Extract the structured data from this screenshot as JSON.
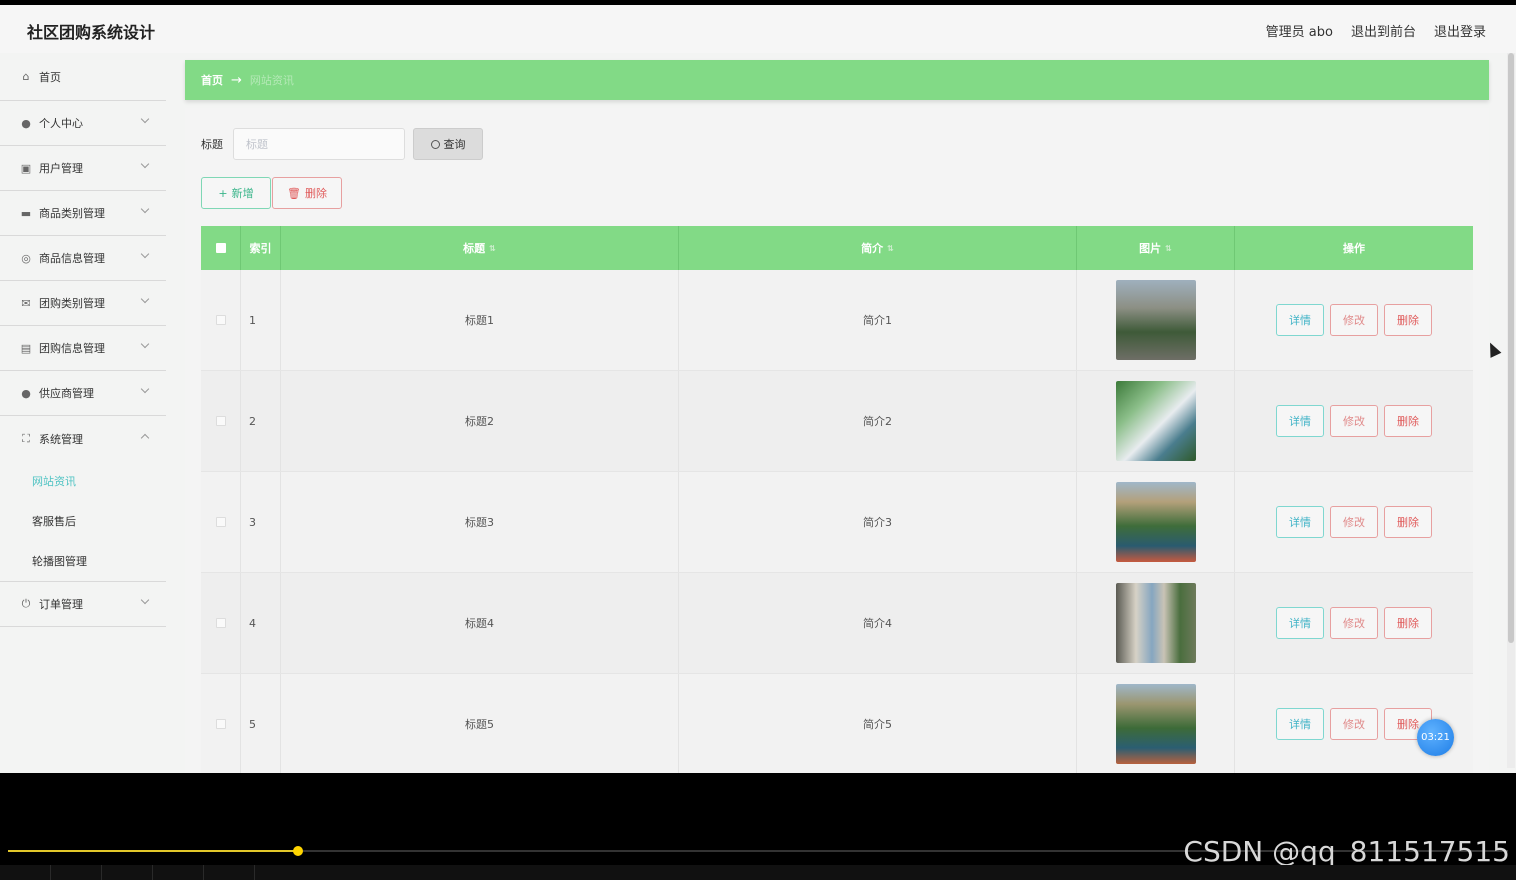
{
  "topbar": {
    "title": "社区团购系统设计",
    "admin": "管理员 abo",
    "front": "退出到前台",
    "logout": "退出登录"
  },
  "sidebar": {
    "items": [
      {
        "label": "首页",
        "icon": "home-icon"
      },
      {
        "label": "个人中心",
        "icon": "user-icon"
      },
      {
        "label": "用户管理",
        "icon": "chart-icon"
      },
      {
        "label": "商品类别管理",
        "icon": "briefcase-icon"
      },
      {
        "label": "商品信息管理",
        "icon": "target-icon"
      },
      {
        "label": "团购类别管理",
        "icon": "mail-icon"
      },
      {
        "label": "团购信息管理",
        "icon": "clipboard-icon"
      },
      {
        "label": "供应商管理",
        "icon": "user-icon"
      },
      {
        "label": "系统管理",
        "icon": "frame-icon"
      },
      {
        "label": "订单管理",
        "icon": "power-icon"
      }
    ],
    "system_sub": [
      "网站资讯",
      "客服售后",
      "轮播图管理"
    ]
  },
  "breadcrumb": {
    "home": "首页",
    "arrow": "→",
    "current": "网站资讯"
  },
  "search": {
    "label": "标题",
    "placeholder": "标题",
    "button": "查询"
  },
  "actions": {
    "add": "新增",
    "delete": "删除"
  },
  "table": {
    "headers": [
      "索引",
      "标题",
      "简介",
      "图片",
      "操作"
    ],
    "rows": [
      {
        "index": "1",
        "title": "标题1",
        "intro": "简介1"
      },
      {
        "index": "2",
        "title": "标题2",
        "intro": "简介2"
      },
      {
        "index": "3",
        "title": "标题3",
        "intro": "简介3"
      },
      {
        "index": "4",
        "title": "标题4",
        "intro": "简介4"
      },
      {
        "index": "5",
        "title": "标题5",
        "intro": "简介5"
      }
    ],
    "ops": {
      "detail": "详情",
      "edit": "修改",
      "remove": "删除"
    }
  },
  "overlay": {
    "timer": "03:21",
    "watermark": "CSDN @qq_811517515"
  },
  "colors": {
    "accent": "#82da86",
    "active_sub": "#4fc3c3"
  }
}
